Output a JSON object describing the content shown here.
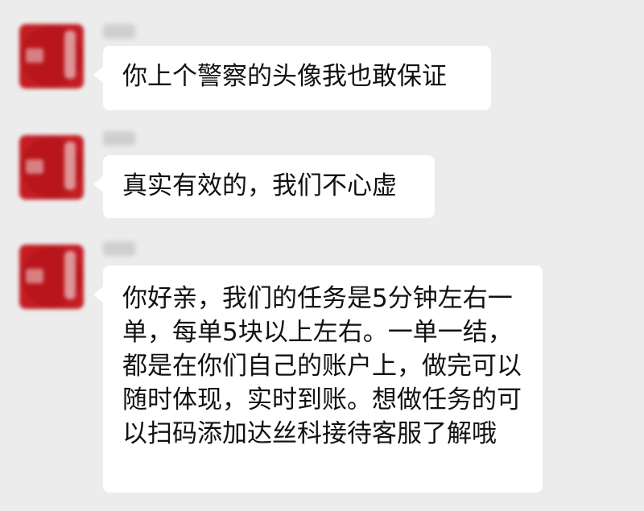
{
  "messages": [
    {
      "sender": "",
      "text": "你上个警察的头像我也敢保证"
    },
    {
      "sender": "",
      "text": "真实有效的，我们不心虚"
    },
    {
      "sender": "",
      "text": "你好亲，我们的任务是5分钟左右一单，每单5块以上左右。一单一结，都是在你们自己的账户上，做完可以随时体现，实时到账。想做任务的可以扫码添加达丝科接待客服了解哦"
    }
  ]
}
